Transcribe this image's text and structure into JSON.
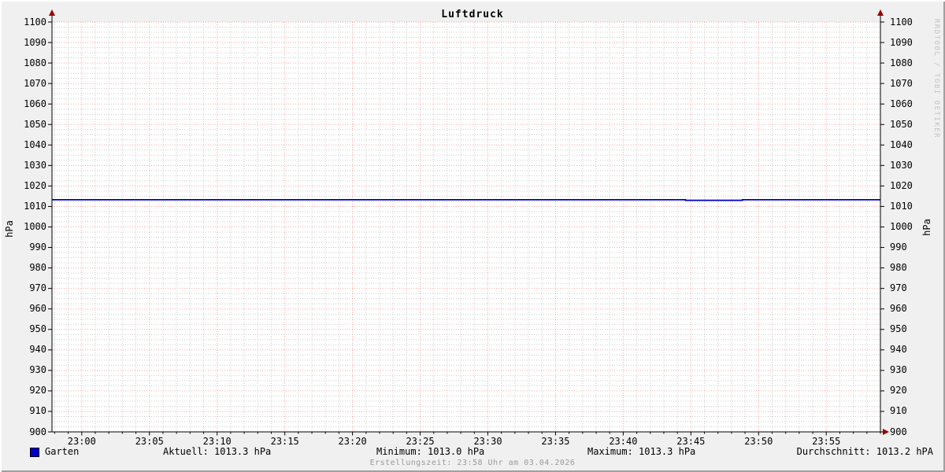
{
  "watermark": "RRDTOOL / TOBI OETIKER",
  "footer": {
    "text": "Erstellungszeit: 23:58 Uhr am 03.04.2026"
  },
  "legend": {
    "series_label": "Garten",
    "series_color": "#0000cc",
    "stats": [
      {
        "text": "Aktuell: 1013.3 hPa"
      },
      {
        "text": "Minimum: 1013.0 hPa"
      },
      {
        "text": "Maximum: 1013.3 hPa"
      },
      {
        "text": "Durchschnitt: 1013.2 hPA"
      }
    ]
  },
  "colors": {
    "background": "#f0f0f0",
    "plot_bg": "#ffffff",
    "major_grid": "#ff0000",
    "minor_grid": "#bbbbbb",
    "axis": "#000000",
    "arrow": "#990000",
    "line": "#0000cc",
    "watermark_text": "#c2c2c2",
    "footer_text": "#9a9a9a"
  },
  "chart_data": {
    "type": "line",
    "title": "Luftdruck",
    "ylabel_left": "hPa",
    "ylabel_right": "hPa",
    "xlabel": "",
    "grid": true,
    "legend_position": "bottom",
    "ylim": [
      900,
      1100
    ],
    "y_major_step": 10,
    "y_minor_step": 2.5,
    "y_ticks": [
      {
        "v": 900,
        "label": "900"
      },
      {
        "v": 910,
        "label": "910"
      },
      {
        "v": 920,
        "label": "920"
      },
      {
        "v": 930,
        "label": "930"
      },
      {
        "v": 940,
        "label": "940"
      },
      {
        "v": 950,
        "label": "950"
      },
      {
        "v": 960,
        "label": "960"
      },
      {
        "v": 970,
        "label": "970"
      },
      {
        "v": 980,
        "label": "980"
      },
      {
        "v": 990,
        "label": "990"
      },
      {
        "v": 1000,
        "label": "1000"
      },
      {
        "v": 1010,
        "label": "1010"
      },
      {
        "v": 1020,
        "label": "1020"
      },
      {
        "v": 1030,
        "label": "1030"
      },
      {
        "v": 1040,
        "label": "1040"
      },
      {
        "v": 1050,
        "label": "1050"
      },
      {
        "v": 1060,
        "label": "1060"
      },
      {
        "v": 1070,
        "label": "1070"
      },
      {
        "v": 1080,
        "label": "1080"
      },
      {
        "v": 1090,
        "label": "1090"
      },
      {
        "v": 1100,
        "label": "1100"
      }
    ],
    "x_axis": {
      "unit": "minutes_after_23:00",
      "start_min": -2.2,
      "end_min": 59,
      "major_step_min": 5,
      "minor_step_min": 1,
      "ticks": [
        {
          "t": 0,
          "label": "23:00"
        },
        {
          "t": 5,
          "label": "23:05"
        },
        {
          "t": 10,
          "label": "23:10"
        },
        {
          "t": 15,
          "label": "23:15"
        },
        {
          "t": 20,
          "label": "23:20"
        },
        {
          "t": 25,
          "label": "23:25"
        },
        {
          "t": 30,
          "label": "23:30"
        },
        {
          "t": 35,
          "label": "23:35"
        },
        {
          "t": 40,
          "label": "23:40"
        },
        {
          "t": 45,
          "label": "23:45"
        },
        {
          "t": 50,
          "label": "23:50"
        },
        {
          "t": 55,
          "label": "23:55"
        }
      ]
    },
    "series": [
      {
        "name": "Garten",
        "color": "#0000cc",
        "points": [
          [
            -2.2,
            1013.3
          ],
          [
            44.6,
            1013.3
          ],
          [
            44.6,
            1013.0
          ],
          [
            48.8,
            1013.0
          ],
          [
            48.8,
            1013.3
          ],
          [
            59.0,
            1013.3
          ]
        ]
      }
    ],
    "stats": {
      "aktuell": 1013.3,
      "minimum": 1013.0,
      "maximum": 1013.3,
      "durchschnitt": 1013.2
    }
  }
}
